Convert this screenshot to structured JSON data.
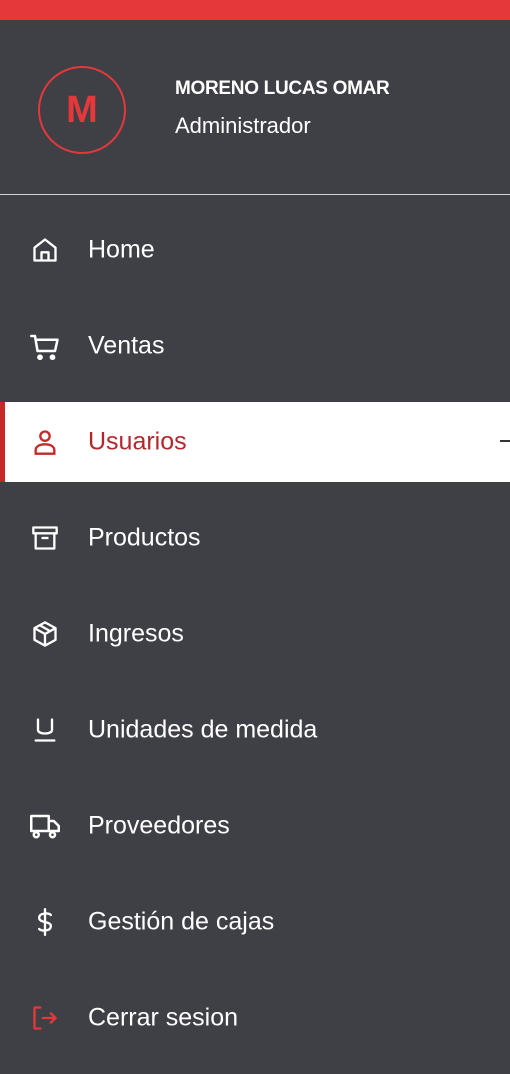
{
  "colors": {
    "accent": "#e5383b",
    "sidebar_bg": "#3f3f46",
    "active_bg": "#ffffff",
    "active_text": "#b3272c"
  },
  "user": {
    "initial": "M",
    "name": "MORENO LUCAS OMAR",
    "role": "Administrador"
  },
  "menu": {
    "items": [
      {
        "label": "Home",
        "icon": "home-icon",
        "active": false
      },
      {
        "label": "Ventas",
        "icon": "cart-icon",
        "active": false
      },
      {
        "label": "Usuarios",
        "icon": "user-icon",
        "active": true
      },
      {
        "label": "Productos",
        "icon": "archive-icon",
        "active": false
      },
      {
        "label": "Ingresos",
        "icon": "cube-icon",
        "active": false
      },
      {
        "label": "Unidades de medida",
        "icon": "units-icon",
        "active": false
      },
      {
        "label": "Proveedores",
        "icon": "truck-icon",
        "active": false
      },
      {
        "label": "Gestión de cajas",
        "icon": "dollar-icon",
        "active": false
      },
      {
        "label": "Cerrar sesion",
        "icon": "logout-icon",
        "active": false
      }
    ]
  }
}
